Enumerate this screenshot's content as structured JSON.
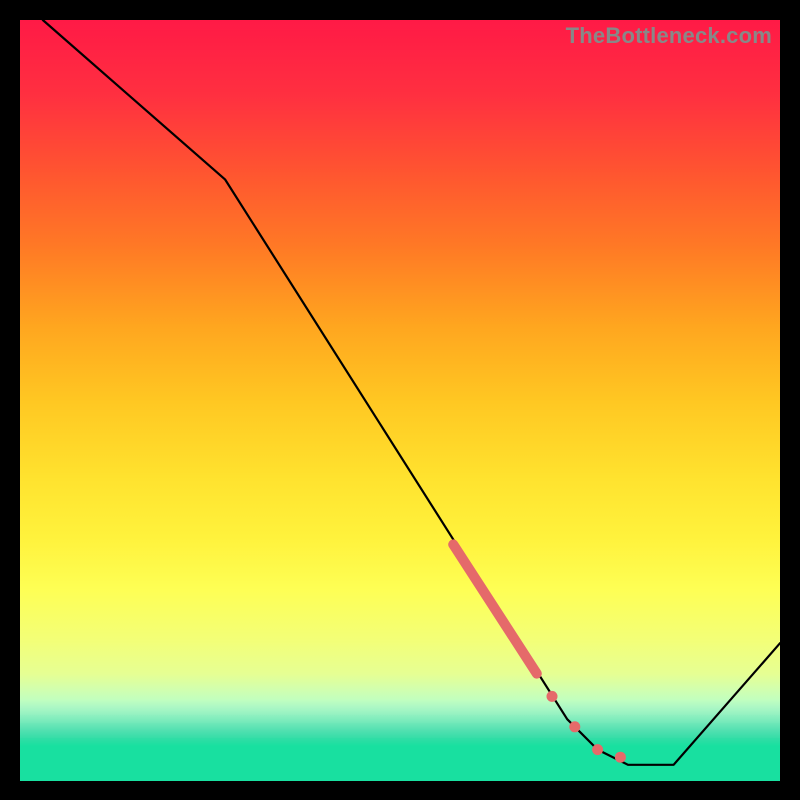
{
  "watermark": "TheBottleneck.com",
  "chart_data": {
    "type": "line",
    "title": "",
    "xlabel": "",
    "ylabel": "",
    "xlim": [
      0,
      100
    ],
    "ylim": [
      0,
      100
    ],
    "gradient_spectrum": [
      {
        "pos": 0.0,
        "color": "#ff1a46"
      },
      {
        "pos": 0.1,
        "color": "#ff3040"
      },
      {
        "pos": 0.2,
        "color": "#ff5530"
      },
      {
        "pos": 0.3,
        "color": "#ff7a25"
      },
      {
        "pos": 0.4,
        "color": "#ffa51f"
      },
      {
        "pos": 0.5,
        "color": "#ffc722"
      },
      {
        "pos": 0.6,
        "color": "#ffe22e"
      },
      {
        "pos": 0.68,
        "color": "#fff23c"
      },
      {
        "pos": 0.75,
        "color": "#feff55"
      },
      {
        "pos": 0.82,
        "color": "#f2ff7a"
      },
      {
        "pos": 0.86,
        "color": "#e6ff93"
      },
      {
        "pos": 0.88,
        "color": "#d2ffae"
      },
      {
        "pos": 0.895,
        "color": "#c0ffc0"
      },
      {
        "pos": 0.905,
        "color": "#aaf7c5"
      },
      {
        "pos": 0.915,
        "color": "#8ff0c0"
      },
      {
        "pos": 0.925,
        "color": "#6fe8b9"
      },
      {
        "pos": 0.935,
        "color": "#50e0b0"
      },
      {
        "pos": 0.945,
        "color": "#32dda6"
      },
      {
        "pos": 0.955,
        "color": "#18e0a0"
      },
      {
        "pos": 1.0,
        "color": "#18e0a0"
      }
    ],
    "series": [
      {
        "name": "bottleneck-curve",
        "type": "line",
        "color": "#000000",
        "points": [
          {
            "x": 3,
            "y": 100
          },
          {
            "x": 27,
            "y": 79
          },
          {
            "x": 72,
            "y": 8
          },
          {
            "x": 76,
            "y": 4
          },
          {
            "x": 80,
            "y": 2
          },
          {
            "x": 86,
            "y": 2
          },
          {
            "x": 100,
            "y": 18
          }
        ]
      },
      {
        "name": "highlight-segment",
        "type": "line",
        "color": "#e56a6a",
        "stroke_width": 10,
        "points": [
          {
            "x": 57,
            "y": 31
          },
          {
            "x": 68,
            "y": 14
          }
        ]
      },
      {
        "name": "marker-dots",
        "type": "scatter",
        "color": "#e56a6a",
        "points": [
          {
            "x": 70,
            "y": 11
          },
          {
            "x": 73,
            "y": 7
          },
          {
            "x": 76,
            "y": 4
          },
          {
            "x": 79,
            "y": 3
          }
        ]
      }
    ]
  }
}
